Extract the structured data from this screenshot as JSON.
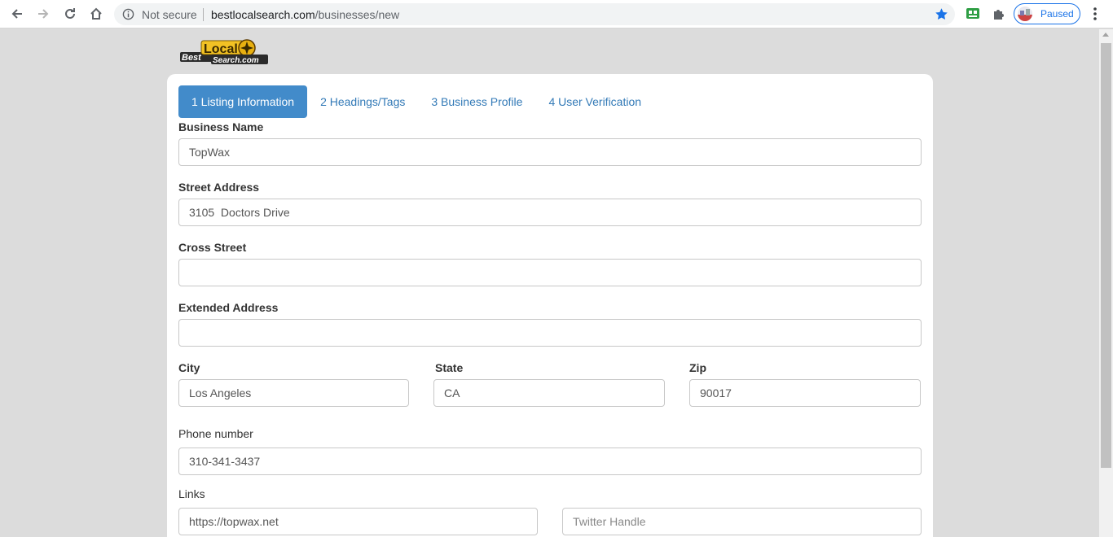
{
  "browser": {
    "security_label": "Not secure",
    "url_domain": "bestlocalsearch.com",
    "url_path": "/businesses/new",
    "profile_label": "Paused"
  },
  "logo": {
    "word1": "Best",
    "word2": "Local",
    "word3": "Search.com"
  },
  "tabs": [
    {
      "label": "1 Listing Information",
      "active": true
    },
    {
      "label": "2 Headings/Tags",
      "active": false
    },
    {
      "label": "3 Business Profile",
      "active": false
    },
    {
      "label": "4 User Verification",
      "active": false
    }
  ],
  "form": {
    "business_name": {
      "label": "Business Name",
      "value": "TopWax"
    },
    "street_address": {
      "label": "Street Address",
      "value": "3105  Doctors Drive"
    },
    "cross_street": {
      "label": "Cross Street",
      "value": ""
    },
    "extended_address": {
      "label": "Extended Address",
      "value": ""
    },
    "city": {
      "label": "City",
      "value": "Los Angeles"
    },
    "state": {
      "label": "State",
      "value": "CA"
    },
    "zip": {
      "label": "Zip",
      "value": "90017"
    },
    "phone": {
      "label": "Phone number",
      "value": "310-341-3437"
    },
    "links": {
      "label": "Links",
      "website_value": "https://topwax.net",
      "twitter_placeholder": "Twitter Handle"
    }
  },
  "colors": {
    "active_tab": "#428bca",
    "tab_link": "#337ab7",
    "page_bg": "#dcdcdc"
  }
}
